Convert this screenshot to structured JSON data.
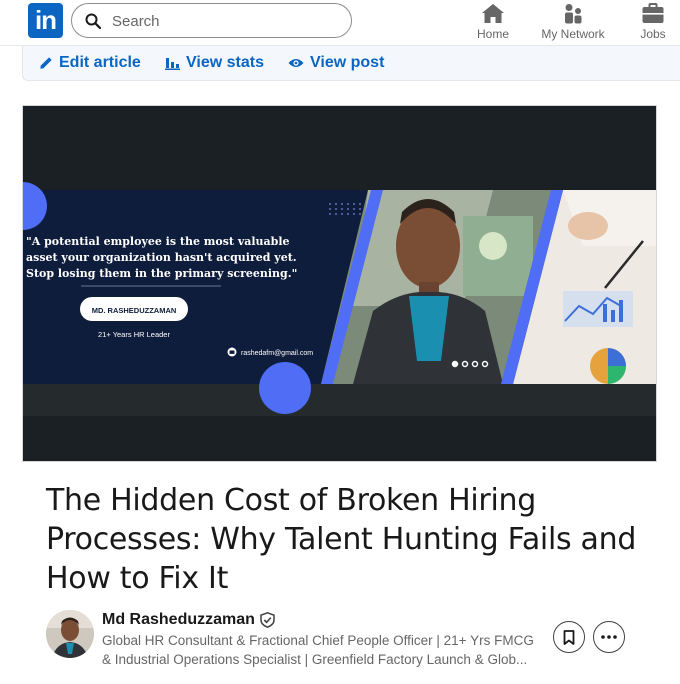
{
  "brand": {
    "logo_text": "in",
    "color": "#0a66c2"
  },
  "search": {
    "placeholder": "Search",
    "icon": "search-icon"
  },
  "nav": {
    "items": [
      {
        "label": "Home",
        "icon": "home-icon"
      },
      {
        "label": "My Network",
        "icon": "people-icon"
      },
      {
        "label": "Jobs",
        "icon": "briefcase-icon"
      }
    ]
  },
  "toolbar": {
    "edit_label": "Edit article",
    "stats_label": "View stats",
    "view_label": "View post"
  },
  "cover": {
    "quote_line1": "\"A potential employee is the most valuable",
    "quote_line2": "asset your organization hasn't acquired yet.",
    "quote_line3": "Stop losing them in the primary screening.\"",
    "name_badge": "MD. RASHEDUZZAMAN",
    "subtitle": "21+ Years HR Leader",
    "email": "rashedafm@gmail.com"
  },
  "article": {
    "title": "The Hidden Cost of Broken Hiring Processes: Why Talent Hunting Fails and How to Fix It"
  },
  "author": {
    "name": "Md Rasheduzzaman",
    "headline_line1": "Global HR Consultant & Fractional Chief People Officer | 21+ Yrs FMCG",
    "headline_line2": "& Industrial Operations Specialist | Greenfield Factory Launch & Glob..."
  },
  "actions": {
    "save_icon": "bookmark-icon",
    "more_icon": "ellipsis-icon"
  }
}
